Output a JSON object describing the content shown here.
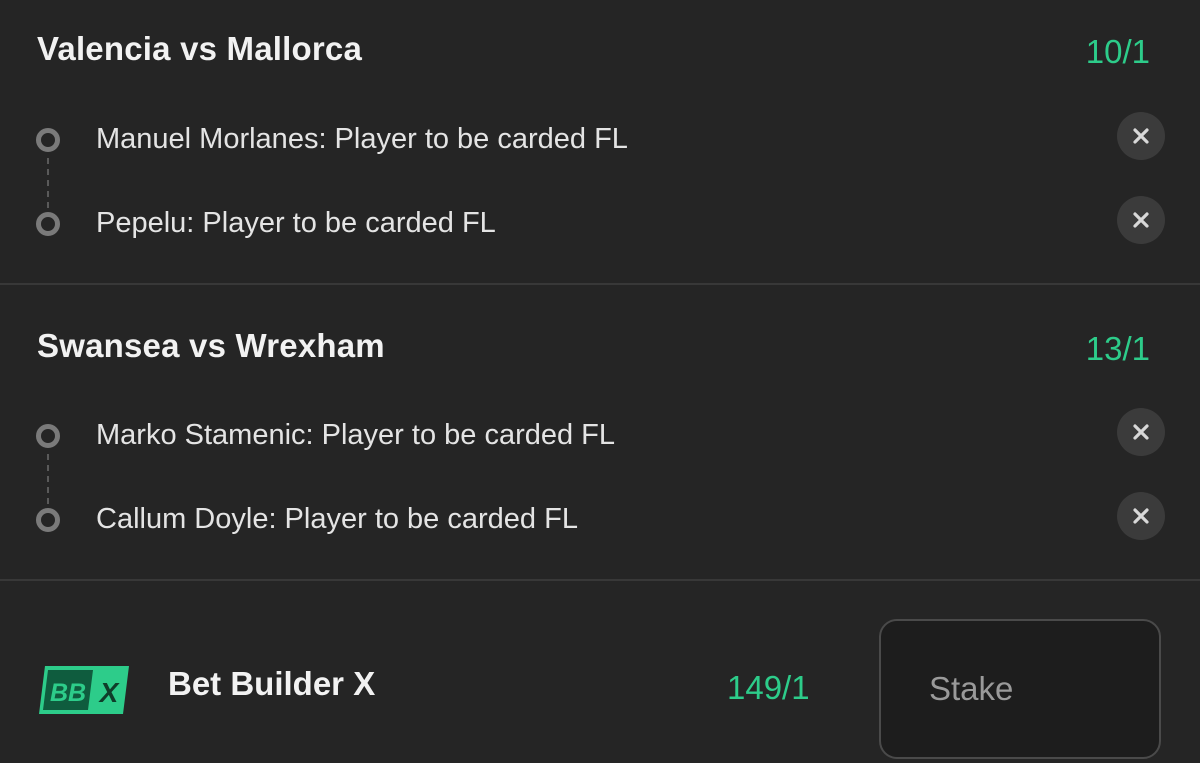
{
  "events": [
    {
      "title": "Valencia vs Mallorca",
      "odds": "10/1",
      "selections": [
        {
          "label": "Manuel Morlanes: Player to be carded FL"
        },
        {
          "label": "Pepelu: Player to be carded FL"
        }
      ]
    },
    {
      "title": "Swansea vs Wrexham",
      "odds": "13/1",
      "selections": [
        {
          "label": "Marko Stamenic: Player to be carded FL"
        },
        {
          "label": "Callum Doyle: Player to be carded FL"
        }
      ]
    }
  ],
  "footer": {
    "logo_text_bb": "BB",
    "logo_text_x": "X",
    "title": "Bet Builder X",
    "odds": "149/1",
    "stake_placeholder": "Stake"
  },
  "icons": {
    "remove": "close-icon",
    "leg": "leg-dot-icon",
    "logo": "bet-builder-x-logo"
  },
  "colors": {
    "background": "#252525",
    "accent_green": "#2dcc8a",
    "text": "#e4e4e4",
    "muted": "#7a7a7a"
  }
}
